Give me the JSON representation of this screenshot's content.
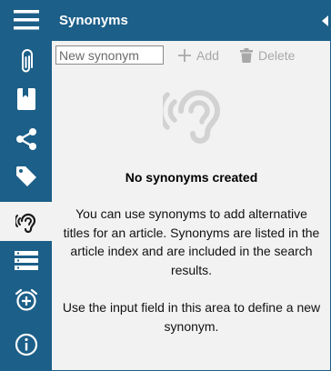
{
  "rail": {
    "items": [
      {
        "name": "menu-icon"
      },
      {
        "name": "attachment-icon"
      },
      {
        "name": "book-icon"
      },
      {
        "name": "share-icon"
      },
      {
        "name": "tag-icon"
      },
      {
        "name": "ear-icon",
        "active": true
      },
      {
        "name": "list-icon"
      },
      {
        "name": "alarm-add-icon"
      },
      {
        "name": "info-icon"
      }
    ],
    "accent": "#1c5f88"
  },
  "panel": {
    "title": "Synonyms",
    "toolbar": {
      "input_placeholder": "New synonym",
      "add_label": "Add",
      "delete_label": "Delete"
    },
    "empty_state": {
      "icon": "ear-icon",
      "title": "No synonyms created",
      "description": "You can use synonyms to add alternative titles for an article. Synonyms are listed in the article index and are included in the search results.",
      "hint": "Use the input field in this area to define a new synonym."
    }
  }
}
